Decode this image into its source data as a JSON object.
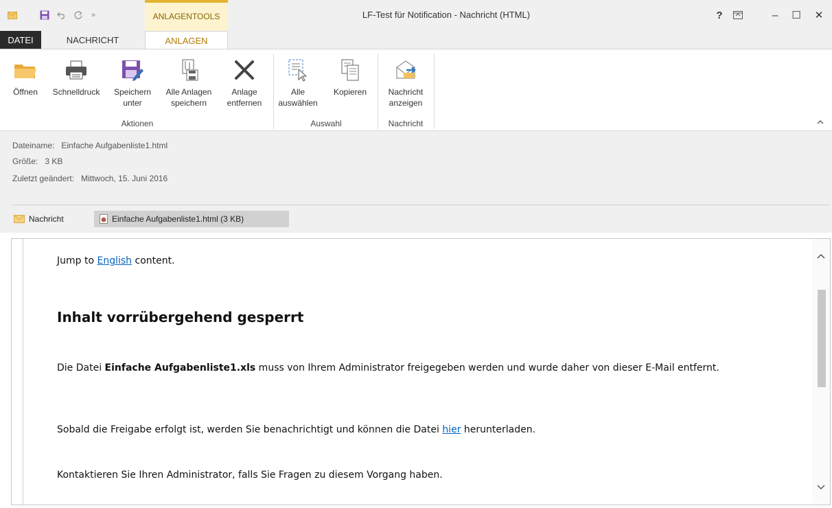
{
  "window": {
    "title": "LF-Test für Notification - Nachricht (HTML)",
    "context_tab_header": "ANLAGENTOOLS",
    "help": "?",
    "controls": {
      "minimize": "–",
      "maximize": "☐",
      "close": "✕"
    }
  },
  "quick_access": {
    "icons": [
      "envelope-icon",
      "save-icon",
      "undo-icon",
      "redo-icon",
      "more-icon"
    ],
    "more_glyph": "»"
  },
  "tabs": {
    "datei": "DATEI",
    "nachricht": "NACHRICHT",
    "anlagen": "ANLAGEN"
  },
  "ribbon": {
    "aktionen": {
      "label": "Aktionen",
      "buttons": {
        "oeffnen": [
          "Öffnen"
        ],
        "schnelldruck": [
          "Schnelldruck"
        ],
        "speichern_unter": [
          "Speichern",
          "unter"
        ],
        "alle_anlagen": [
          "Alle Anlagen",
          "speichern"
        ],
        "anlage_entfernen": [
          "Anlage",
          "entfernen"
        ]
      }
    },
    "auswahl": {
      "label": "Auswahl",
      "buttons": {
        "alle_auswaehlen": [
          "Alle",
          "auswählen"
        ],
        "kopieren": [
          "Kopieren"
        ]
      }
    },
    "nachricht": {
      "label": "Nachricht",
      "buttons": {
        "nachricht_anzeigen": [
          "Nachricht",
          "anzeigen"
        ]
      }
    }
  },
  "info": {
    "dateiname_label": "Dateiname:",
    "dateiname_value": "Einfache Aufgabenliste1.html",
    "groesse_label": "Größe:",
    "groesse_value": "3 KB",
    "geaendert_label": "Zuletzt geändert:",
    "geaendert_value": "Mittwoch, 15. Juni 2016"
  },
  "attachments": {
    "message": "Nachricht",
    "file": "Einfache Aufgabenliste1.html (3 KB)"
  },
  "content": {
    "jump_pre": "Jump to ",
    "jump_link": "English",
    "jump_post": " content.",
    "heading": "Inhalt vorrübergehend gesperrt",
    "p2_pre": "Die Datei ",
    "p2_bold": "Einfache Aufgabenliste1.xls",
    "p2_post": " muss von Ihrem Administrator freigegeben werden und wurde daher von dieser E-Mail entfernt.",
    "p3_pre": "Sobald die Freigabe erfolgt ist, werden Sie benachrichtigt und können die Datei ",
    "p3_link": "hier",
    "p3_post": " herunterladen.",
    "p4": "Kontaktieren Sie Ihren Administrator, falls Sie Fragen zu diesem Vorgang haben."
  },
  "colors": {
    "accent": "#e4b331",
    "link": "#0563c1",
    "save_purple": "#7d4fae"
  }
}
